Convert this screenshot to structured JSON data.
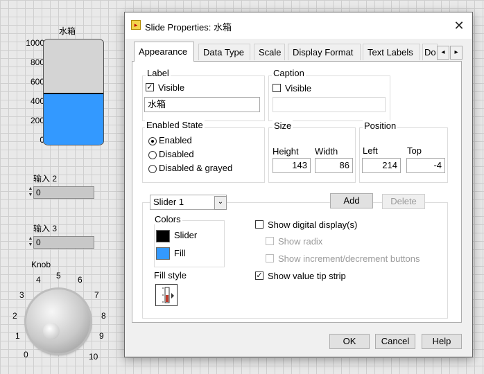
{
  "front_panel": {
    "tank": {
      "title": "水箱",
      "scale": [
        "1000",
        "800",
        "600",
        "400",
        "200",
        "0"
      ],
      "fill_fraction": 0.48
    },
    "inputs": [
      {
        "label": "输入 2",
        "value": "0"
      },
      {
        "label": "输入 3",
        "value": "0"
      }
    ],
    "knob": {
      "label": "Knob",
      "scale": [
        "0",
        "1",
        "2",
        "3",
        "4",
        "5",
        "6",
        "7",
        "8",
        "9",
        "10"
      ]
    }
  },
  "dialog": {
    "title": "Slide Properties: 水箱",
    "close_glyph": "✕",
    "tabs": [
      "Appearance",
      "Data Type",
      "Scale",
      "Display Format",
      "Text Labels",
      "Do"
    ],
    "active_tab": "Appearance",
    "tab_scroll_left": "◂",
    "tab_scroll_right": "▸",
    "label_group": {
      "title": "Label",
      "visible_label": "Visible",
      "visible_checked": true,
      "value": "水箱"
    },
    "caption_group": {
      "title": "Caption",
      "visible_label": "Visible",
      "visible_checked": false,
      "value": ""
    },
    "enabled_state": {
      "title": "Enabled State",
      "options": [
        "Enabled",
        "Disabled",
        "Disabled & grayed"
      ],
      "selected": "Enabled"
    },
    "size": {
      "title": "Size",
      "height_label": "Height",
      "width_label": "Width",
      "height": "143",
      "width": "86"
    },
    "position": {
      "title": "Position",
      "left_label": "Left",
      "top_label": "Top",
      "left": "214",
      "top": "-4"
    },
    "slider": {
      "selected": "Slider 1",
      "add_label": "Add",
      "delete_label": "Delete",
      "colors_title": "Colors",
      "colors": [
        {
          "label": "Slider",
          "color": "#000000"
        },
        {
          "label": "Fill",
          "color": "#3399ff"
        }
      ],
      "fill_style_label": "Fill style",
      "options": [
        {
          "label": "Show digital display(s)",
          "checked": false,
          "enabled": true
        },
        {
          "label": "Show radix",
          "checked": false,
          "enabled": false
        },
        {
          "label": "Show increment/decrement buttons",
          "checked": false,
          "enabled": false
        },
        {
          "label": "Show value tip strip",
          "checked": true,
          "enabled": true
        }
      ]
    },
    "buttons": {
      "ok": "OK",
      "cancel": "Cancel",
      "help": "Help"
    }
  }
}
